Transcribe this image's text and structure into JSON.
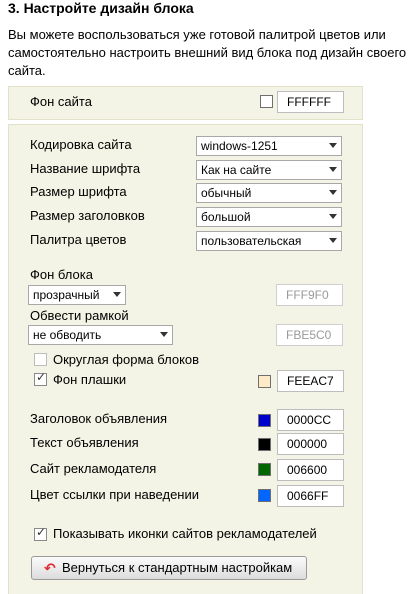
{
  "heading": "3. Настройте дизайн блока",
  "description": "Вы можете воспользоваться уже готовой палитрой цветов или самостоятельно настроить внешний вид блока под дизайн своего сайта.",
  "site_bg": {
    "label": "Фон сайта",
    "value": "FFFFFF",
    "color": "#ffffff"
  },
  "fields": {
    "encoding": {
      "label": "Кодировка сайта",
      "value": "windows-1251"
    },
    "font_name": {
      "label": "Название шрифта",
      "value": "Как на сайте"
    },
    "font_size": {
      "label": "Размер шрифта",
      "value": "обычный"
    },
    "heading_size": {
      "label": "Размер заголовков",
      "value": "большой"
    },
    "palette": {
      "label": "Палитра цветов",
      "value": "пользовательская"
    }
  },
  "block_bg": {
    "label": "Фон блока",
    "value": "прозрачный",
    "hex": "FFF9F0"
  },
  "border": {
    "label": "Обвести рамкой",
    "value": "не обводить",
    "hex": "FBE5C0"
  },
  "rounded": {
    "label": "Округлая форма блоков",
    "checked": false
  },
  "plate_bg": {
    "label": "Фон плашки",
    "checked": true,
    "hex": "FEEAC7",
    "color": "#feeac7"
  },
  "colors": {
    "ad_title": {
      "label": "Заголовок объявления",
      "hex": "0000CC",
      "color": "#0000cc"
    },
    "ad_text": {
      "label": "Текст объявления",
      "hex": "000000",
      "color": "#000000"
    },
    "advertiser": {
      "label": "Сайт рекламодателя",
      "hex": "006600",
      "color": "#006600"
    },
    "link_hover": {
      "label": "Цвет ссылки при наведении",
      "hex": "0066FF",
      "color": "#0066ff"
    }
  },
  "show_icons": {
    "label": "Показывать иконки сайтов рекламодателей",
    "checked": true
  },
  "reset_button": {
    "label": "Вернуться к стандартным настройкам"
  }
}
